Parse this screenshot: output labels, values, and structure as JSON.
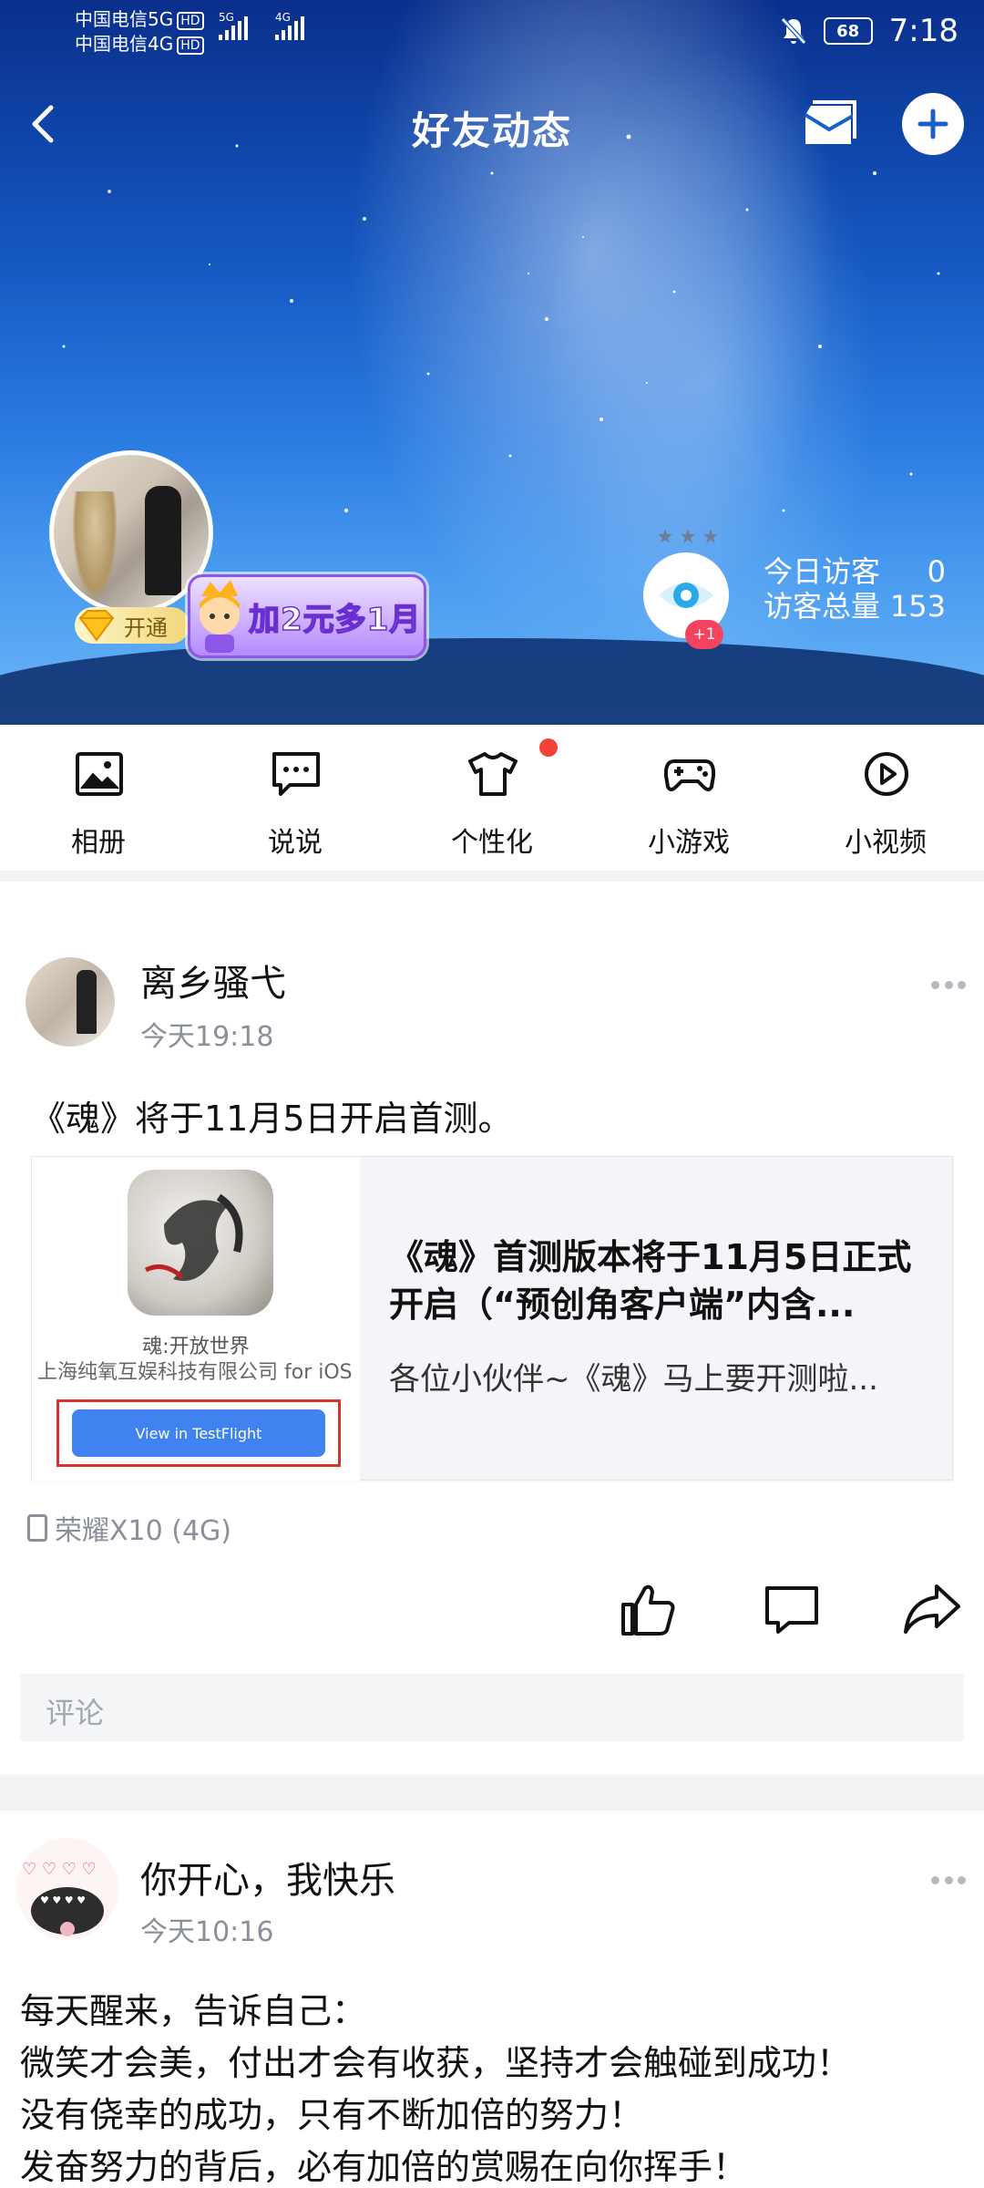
{
  "status_bar": {
    "carrier1": "中国电信5G",
    "carrier2": "中国电信4G",
    "hd": "HD",
    "net1": "5G",
    "net2": "4G",
    "battery": "68",
    "time": "7:18"
  },
  "header": {
    "title": "好友动态"
  },
  "profile": {
    "vip_label": "开通",
    "promo_text": "加2元多1月",
    "visitor_badge": "+1",
    "today_visitors_label": "今日访客",
    "today_visitors_value": "0",
    "total_visitors_label": "访客总量",
    "total_visitors_value": "153"
  },
  "nav": {
    "items": [
      {
        "label": "相册",
        "icon": "photo-album-icon"
      },
      {
        "label": "说说",
        "icon": "chat-bubble-icon"
      },
      {
        "label": "个性化",
        "icon": "tshirt-icon"
      },
      {
        "label": "小游戏",
        "icon": "gamepad-icon"
      },
      {
        "label": "小视频",
        "icon": "play-circle-icon"
      }
    ]
  },
  "posts": [
    {
      "username": "离乡骚弋",
      "time": "今天19:18",
      "text": "《魂》将于11月5日开启首测。",
      "card": {
        "app_name": "魂:开放世界",
        "developer": "上海纯氧互娱科技有限公司 for iOS",
        "button": "View in TestFlight",
        "title": "《魂》首测版本将于11月5日正式开启（“预创角客户端”内含...",
        "desc": "各位小伙伴~《魂》马上要开测啦..."
      },
      "device": "荣耀X10 (4G)",
      "comment_placeholder": "评论"
    },
    {
      "username": "你开心，我快乐",
      "time": "今天10:16",
      "lines": [
        "每天醒来，告诉自己：",
        "微笑才会美，付出才会有收获，坚持才会触碰到成功！",
        "没有侥幸的成功，只有不断加倍的努力！",
        "发奋努力的背后，必有加倍的赏赐在向你挥手！"
      ]
    }
  ]
}
